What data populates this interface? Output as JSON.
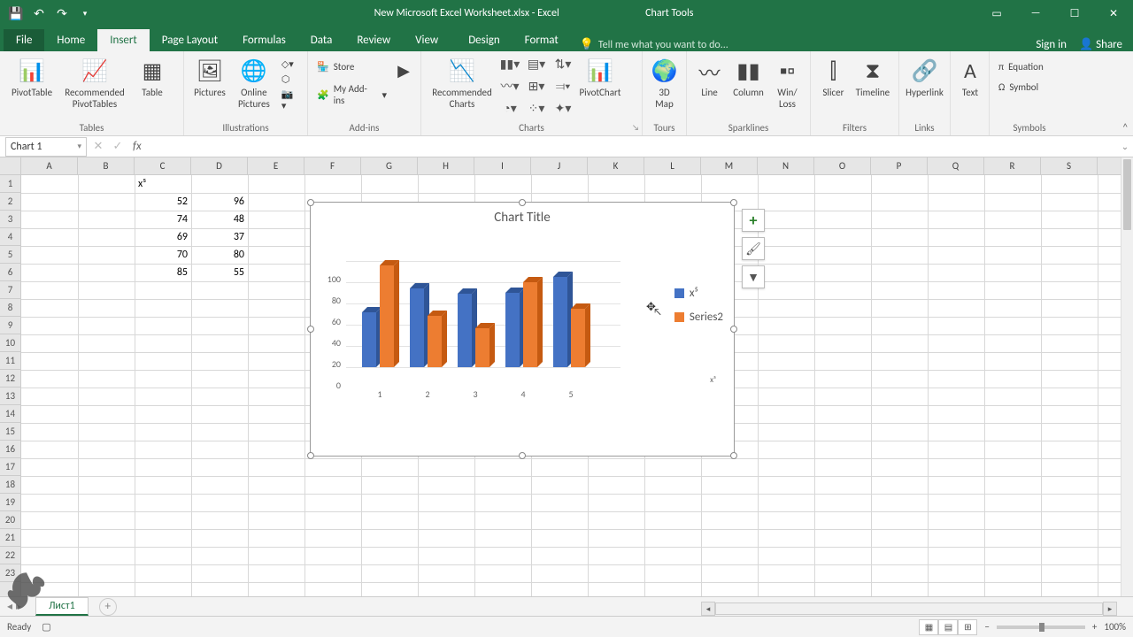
{
  "titlebar": {
    "title": "New Microsoft Excel Worksheet.xlsx - Excel",
    "chart_tools": "Chart Tools"
  },
  "tabs": {
    "file": "File",
    "home": "Home",
    "insert": "Insert",
    "page_layout": "Page Layout",
    "formulas": "Formulas",
    "data": "Data",
    "review": "Review",
    "view": "View",
    "design": "Design",
    "format": "Format"
  },
  "tellme": "Tell me what you want to do...",
  "signin": "Sign in",
  "share": "Share",
  "ribbon": {
    "tables": {
      "label": "Tables",
      "pivot": "PivotTable",
      "recommended": "Recommended\nPivotTables",
      "table": "Table"
    },
    "illustrations": {
      "label": "Illustrations",
      "pictures": "Pictures",
      "online": "Online\nPictures"
    },
    "addins": {
      "label": "Add-ins",
      "store": "Store",
      "myaddins": "My Add-ins"
    },
    "charts": {
      "label": "Charts",
      "recommended": "Recommended\nCharts",
      "pivotchart": "PivotChart"
    },
    "tours": {
      "label": "Tours",
      "map3d": "3D\nMap"
    },
    "sparklines": {
      "label": "Sparklines",
      "line": "Line",
      "column": "Column",
      "winloss": "Win/\nLoss"
    },
    "filters": {
      "label": "Filters",
      "slicer": "Slicer",
      "timeline": "Timeline"
    },
    "links": {
      "label": "Links",
      "hyperlink": "Hyperlink"
    },
    "text": {
      "label": "",
      "text": "Text"
    },
    "symbols": {
      "label": "Symbols",
      "equation": "Equation",
      "symbol": "Symbol"
    }
  },
  "namebox": "Chart 1",
  "columns": [
    "A",
    "B",
    "C",
    "D",
    "E",
    "F",
    "G",
    "H",
    "I",
    "J",
    "K",
    "L",
    "M",
    "N",
    "O",
    "P",
    "Q",
    "R",
    "S"
  ],
  "rows": 23,
  "cells": {
    "C1": "x⁵",
    "C2": "52",
    "D2": "96",
    "C3": "74",
    "D3": "48",
    "C4": "69",
    "D4": "37",
    "C5": "70",
    "D5": "80",
    "C6": "85",
    "D6": "55"
  },
  "chart": {
    "title": "Chart Title",
    "legend": {
      "s1": "x⁵",
      "s2": "Series2"
    },
    "xtitle": "x⁵",
    "colors": {
      "s1": "#4472C4",
      "s2": "#ED7D31",
      "s1d": "#2F5597",
      "s2d": "#C55A11"
    }
  },
  "chart_data": {
    "type": "bar",
    "categories": [
      "1",
      "2",
      "3",
      "4",
      "5"
    ],
    "series": [
      {
        "name": "x⁵",
        "values": [
          52,
          74,
          69,
          70,
          85
        ]
      },
      {
        "name": "Series2",
        "values": [
          96,
          48,
          37,
          80,
          55
        ]
      }
    ],
    "title": "Chart Title",
    "xlabel": "x⁵",
    "ylabel": "",
    "ylim": [
      0,
      100
    ],
    "yticks": [
      0,
      20,
      40,
      60,
      80,
      100
    ]
  },
  "sheet_tab": "Лист1",
  "status": {
    "ready": "Ready",
    "zoom": "100%"
  }
}
